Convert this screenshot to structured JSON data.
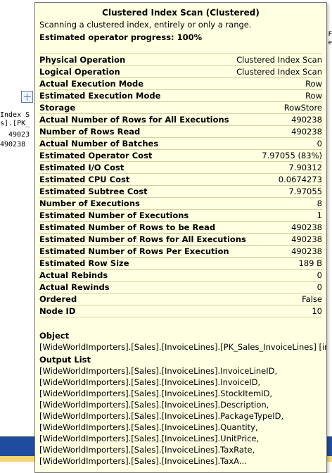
{
  "background": {
    "node_lines": [
      "Index S",
      "s].[PK_",
      "49023",
      "490238"
    ],
    "right_glyphs": [
      "F",
      "e"
    ],
    "colors": {
      "strip_top": "#1f4c9e",
      "strip_mid": "#f2d77a"
    }
  },
  "tooltip": {
    "title": "Clustered Index Scan (Clustered)",
    "description": "Scanning a clustered index, entirely or only a range.",
    "progress": "Estimated operator progress: 100%",
    "properties": [
      {
        "label": "Physical Operation",
        "value": "Clustered Index Scan"
      },
      {
        "label": "Logical Operation",
        "value": "Clustered Index Scan"
      },
      {
        "label": "Actual Execution Mode",
        "value": "Row"
      },
      {
        "label": "Estimated Execution Mode",
        "value": "Row"
      },
      {
        "label": "Storage",
        "value": "RowStore"
      },
      {
        "label": "Actual Number of Rows for All Executions",
        "value": "490238"
      },
      {
        "label": "Number of Rows Read",
        "value": "490238"
      },
      {
        "label": "Actual Number of Batches",
        "value": "0"
      },
      {
        "label": "Estimated Operator Cost",
        "value": "7.97055 (83%)"
      },
      {
        "label": "Estimated I/O Cost",
        "value": "7.90312"
      },
      {
        "label": "Estimated CPU Cost",
        "value": "0.0674273"
      },
      {
        "label": "Estimated Subtree Cost",
        "value": "7.97055"
      },
      {
        "label": "Number of Executions",
        "value": "8"
      },
      {
        "label": "Estimated Number of Executions",
        "value": "1"
      },
      {
        "label": "Estimated Number of Rows to be Read",
        "value": "490238"
      },
      {
        "label": "Estimated Number of Rows for All Executions",
        "value": "490238"
      },
      {
        "label": "Estimated Number of Rows Per Execution",
        "value": "490238"
      },
      {
        "label": "Estimated Row Size",
        "value": "189 B"
      },
      {
        "label": "Actual Rebinds",
        "value": "0"
      },
      {
        "label": "Actual Rewinds",
        "value": "0"
      },
      {
        "label": "Ordered",
        "value": "False"
      },
      {
        "label": "Node ID",
        "value": "10"
      }
    ],
    "object": {
      "title": "Object",
      "value": "[WideWorldImporters].[Sales].[InvoiceLines].[PK_Sales_InvoiceLines] [invl]"
    },
    "output_list": {
      "title": "Output List",
      "lines": [
        "[WideWorldImporters].[Sales].[InvoiceLines].InvoiceLineID,",
        "[WideWorldImporters].[Sales].[InvoiceLines].InvoiceID,",
        "[WideWorldImporters].[Sales].[InvoiceLines].StockItemID,",
        "[WideWorldImporters].[Sales].[InvoiceLines].Description,",
        "[WideWorldImporters].[Sales].[InvoiceLines].PackageTypeID,",
        "[WideWorldImporters].[Sales].[InvoiceLines].Quantity,",
        "[WideWorldImporters].[Sales].[InvoiceLines].UnitPrice,",
        "[WideWorldImporters].[Sales].[InvoiceLines].TaxRate,",
        "[WideWorldImporters].[Sales].[InvoiceLines].TaxA..."
      ]
    }
  }
}
